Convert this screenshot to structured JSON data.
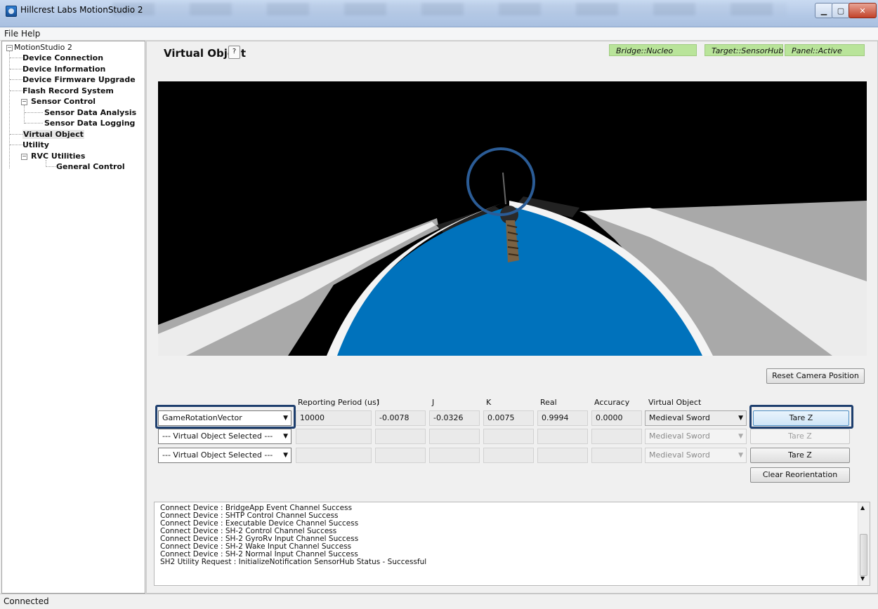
{
  "window": {
    "title": "Hillcrest Labs MotionStudio 2"
  },
  "menu": {
    "file": "File",
    "help": "Help"
  },
  "tree": [
    {
      "label": "MotionStudio 2"
    },
    {
      "label": "Device Connection"
    },
    {
      "label": "Device Information"
    },
    {
      "label": "Device Firmware Upgrade"
    },
    {
      "label": "Flash Record System"
    },
    {
      "label": "Sensor Control"
    },
    {
      "label": "Sensor Data Analysis"
    },
    {
      "label": "Sensor Data Logging"
    },
    {
      "label": "Virtual Object"
    },
    {
      "label": "Utility"
    },
    {
      "label": "RVC Utilities"
    },
    {
      "label": "General Control"
    }
  ],
  "page": {
    "title": "Virtual Object",
    "help": "?"
  },
  "status_badges": [
    "Bridge::Nucleo",
    "Target::SensorHub",
    "Panel::Active"
  ],
  "reset_camera": "Reset Camera Position",
  "columns": {
    "period": "Reporting Period (us)",
    "i": "I",
    "j": "J",
    "k": "K",
    "real": "Real",
    "accuracy": "Accuracy",
    "vobj": "Virtual Object"
  },
  "rows": [
    {
      "sensor": "GameRotationVector",
      "period": "10000",
      "i": "-0.0078",
      "j": "-0.0326",
      "k": "0.0075",
      "real": "0.9994",
      "accuracy": "0.0000",
      "vobj": "Medieval Sword",
      "tare": "Tare Z"
    },
    {
      "sensor": "--- Virtual Object Selected ---",
      "period": "",
      "i": "",
      "j": "",
      "k": "",
      "real": "",
      "accuracy": "",
      "vobj": "Medieval Sword",
      "tare": "Tare Z"
    },
    {
      "sensor": "--- Virtual Object Selected ---",
      "period": "",
      "i": "",
      "j": "",
      "k": "",
      "real": "",
      "accuracy": "",
      "vobj": "Medieval Sword",
      "tare": "Tare Z"
    }
  ],
  "clear_reorientation": "Clear Reorientation",
  "log": [
    "Connect Device : BridgeApp Event Channel Success",
    "Connect Device : SHTP Control Channel Success",
    "Connect Device : Executable Device Channel Success",
    "Connect Device : SH-2 Control Channel Success",
    "Connect Device : SH-2 GyroRv Input Channel Success",
    "Connect Device : SH-2 Wake Input Channel Success",
    "Connect Device : SH-2 Normal Input Channel Success",
    "SH2 Utility Request : InitializeNotification SensorHub Status - Successful"
  ],
  "status": "Connected",
  "colors": {
    "track_blue": "#0072bc",
    "badge_green": "#b9e49a",
    "highlight": "#1e3f6e"
  }
}
